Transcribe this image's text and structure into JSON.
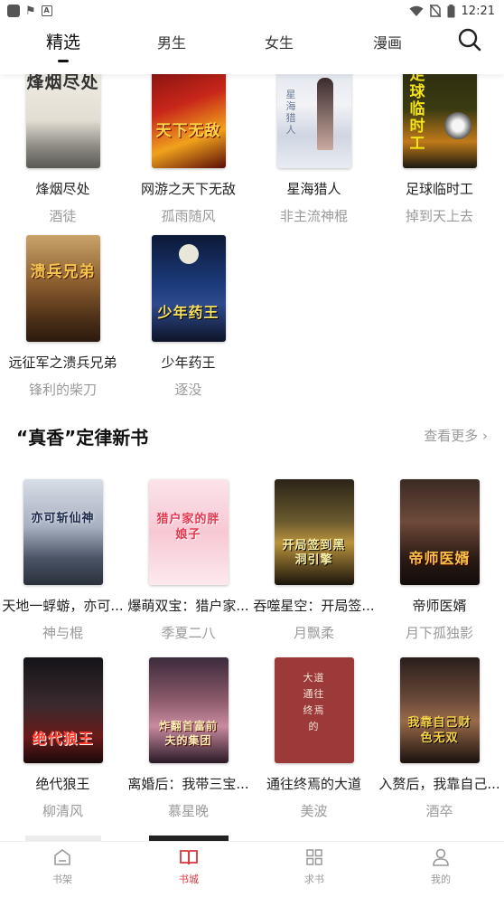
{
  "status_bar": {
    "time": "12:21"
  },
  "tabs": [
    {
      "label": "精选",
      "active": true
    },
    {
      "label": "男生",
      "active": false
    },
    {
      "label": "女生",
      "active": false
    },
    {
      "label": "漫画",
      "active": false
    }
  ],
  "top_books": [
    {
      "title": "烽烟尽处",
      "author": "酒徒",
      "cover_text": "烽烟尽处"
    },
    {
      "title": "网游之天下无敌",
      "author": "孤雨随风",
      "cover_text": "天下无敌"
    },
    {
      "title": "星海猎人",
      "author": "非主流神棍",
      "cover_text": "星海猎人"
    },
    {
      "title": "足球临时工",
      "author": "掉到天上去",
      "cover_text": "足球临时工"
    },
    {
      "title": "远征军之溃兵兄弟",
      "author": "锋利的柴刀",
      "cover_text": "溃兵兄弟"
    },
    {
      "title": "少年药王",
      "author": "逐没",
      "cover_text": "少年药王"
    }
  ],
  "section": {
    "title": "“真香”定律新书",
    "see_more": "查看更多 ›"
  },
  "section_books": [
    {
      "title": "天地一蜉蝣，亦可...",
      "author": "神与棍",
      "cover_text": "亦可斩仙神"
    },
    {
      "title": "爆萌双宝：猎户家...",
      "author": "季夏二八",
      "cover_text": "猎户家的胖娘子"
    },
    {
      "title": "吞噬星空：开局签...",
      "author": "月飘柔",
      "cover_text": "开局签到黑洞引擎"
    },
    {
      "title": "帝师医婿",
      "author": "月下孤独影",
      "cover_text": "帝师医婿"
    },
    {
      "title": "绝代狼王",
      "author": "柳清风",
      "cover_text": "绝代狼王"
    },
    {
      "title": "离婚后：我带三宝...",
      "author": "慕星晚",
      "cover_text": "炸翻首富前夫的集团"
    },
    {
      "title": "通往终焉的大道",
      "author": "美波",
      "cover_text": "大道 通往终焉的"
    },
    {
      "title": "入赘后，我靠自己...",
      "author": "酒卒",
      "cover_text": "我靠自己财色无双"
    }
  ],
  "bottom_nav": [
    {
      "label": "书架",
      "icon": "bookshelf-icon",
      "active": false
    },
    {
      "label": "书城",
      "icon": "book-open-icon",
      "active": true
    },
    {
      "label": "求书",
      "icon": "grid-icon",
      "active": false
    },
    {
      "label": "我的",
      "icon": "user-icon",
      "active": false
    }
  ],
  "colors": {
    "accent": "#d9363e",
    "muted": "#9a9a9a"
  }
}
